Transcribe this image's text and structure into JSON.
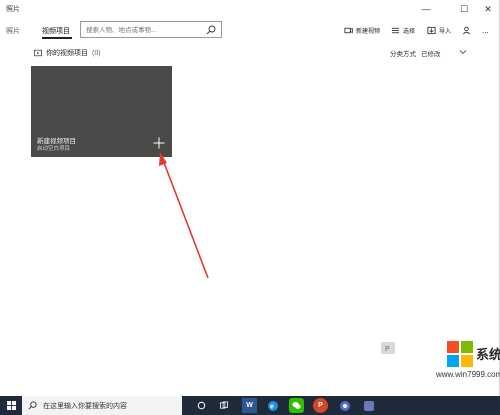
{
  "window": {
    "app_title": "照片",
    "controls": {
      "minimize": "—",
      "maximize": "☐",
      "close": "✕"
    }
  },
  "nav": {
    "photos": "照片",
    "video_projects": "视频项目"
  },
  "search": {
    "placeholder": "搜索人物、地点或事物..."
  },
  "commands": {
    "new_video": "新建视频",
    "select": "选择",
    "import": "导入",
    "more": "..."
  },
  "section": {
    "title": "你的视频项目",
    "count": "(0)"
  },
  "sort": {
    "label": "分类方式",
    "value": "已修改"
  },
  "card": {
    "title": "新建视频项目",
    "subtitle": "启动空白项目"
  },
  "watermark": {
    "text": "系统粉",
    "url": "www.win7999.com"
  },
  "taskbar": {
    "search_placeholder": "在这里输入你要搜索的内容"
  },
  "colors": {
    "card_bg": "#4a4a48",
    "arrow": "#e03a2f",
    "taskbar_bg": "#1f2a3a"
  }
}
